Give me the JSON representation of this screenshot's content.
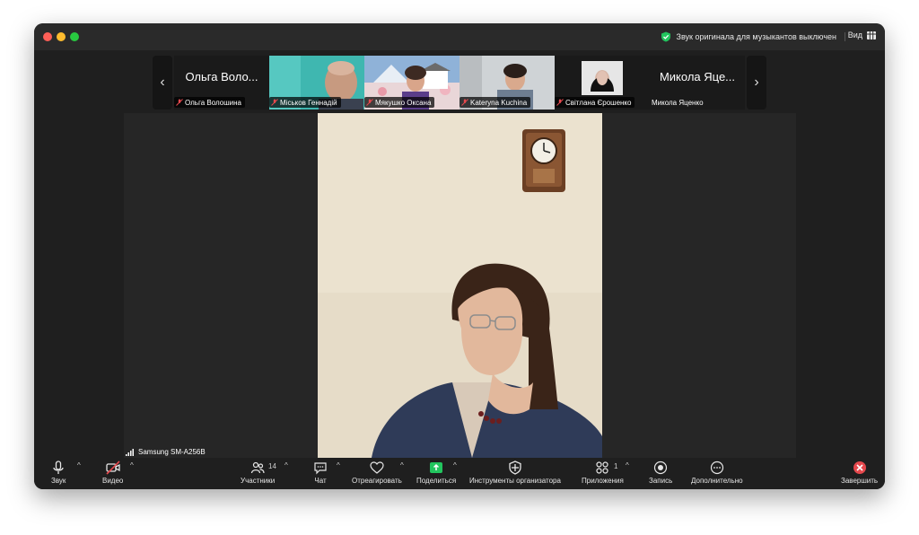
{
  "notice": {
    "text": "Звук оригинала для музыкантов выключен",
    "view_label": "Вид"
  },
  "strip": {
    "participants": [
      {
        "name": "Ольга Волошина",
        "display": "Ольга Воло...",
        "muted": true
      },
      {
        "name": "Міськов Геннадій",
        "muted": true
      },
      {
        "name": "Мякушко Оксана",
        "muted": true
      },
      {
        "name": "Kateryna Kuchina",
        "muted": true
      },
      {
        "name": "Світлана Єрошенко",
        "muted": true
      },
      {
        "name": "Микола Яценко",
        "display": "Микола Яце...",
        "muted": false
      }
    ]
  },
  "main": {
    "device_label": "Samsung SM-A256B"
  },
  "toolbar": {
    "audio": "Звук",
    "video": "Видео",
    "participants": "Участники",
    "participants_count": "14",
    "chat": "Чат",
    "react": "Отреагировать",
    "share": "Поделиться",
    "host_tools": "Инструменты организатора",
    "apps": "Приложения",
    "apps_count": "1",
    "record": "Запись",
    "more": "Дополнительно",
    "end": "Завершить"
  },
  "colors": {
    "accent_green": "#22c55e",
    "end_red": "#e5484d",
    "mute_red": "#e5484d"
  }
}
